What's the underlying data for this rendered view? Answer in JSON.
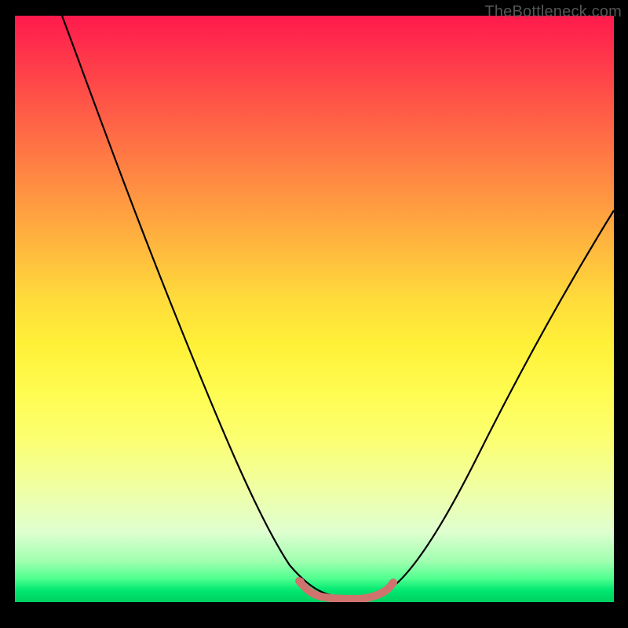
{
  "watermark": "TheBottleneck.com",
  "chart_data": {
    "type": "line",
    "title": "",
    "xlabel": "",
    "ylabel": "",
    "xlim": [
      0,
      100
    ],
    "ylim": [
      0,
      100
    ],
    "series": [
      {
        "name": "bottleneck-curve",
        "x": [
          10,
          14,
          18,
          22,
          26,
          30,
          34,
          38,
          42,
          46,
          48,
          50,
          52,
          54,
          56,
          58,
          60,
          62,
          66,
          70,
          74,
          78,
          82,
          86,
          90,
          94,
          98,
          100
        ],
        "y": [
          100,
          90,
          80,
          70,
          60,
          50,
          41,
          32,
          23,
          14,
          9,
          5,
          2.5,
          1.8,
          1.5,
          1.5,
          1.5,
          2,
          4,
          9,
          15,
          22,
          30,
          38,
          46,
          54,
          62,
          66
        ]
      },
      {
        "name": "flat-valley-marker",
        "x": [
          50,
          52,
          54,
          56,
          58,
          60,
          62
        ],
        "y": [
          2.5,
          1.8,
          1.5,
          1.5,
          1.5,
          1.5,
          2
        ]
      }
    ],
    "colors": {
      "curve": "#000000",
      "marker": "#d0736e",
      "gradient_top": "#ff1a4d",
      "gradient_bottom": "#00d060"
    }
  }
}
